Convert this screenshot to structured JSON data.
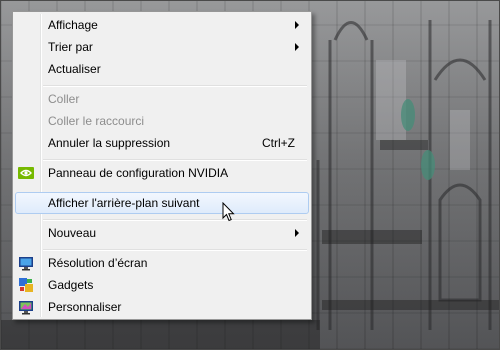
{
  "context_menu": {
    "items": [
      {
        "label": "Affichage"
      },
      {
        "label": "Trier par"
      },
      {
        "label": "Actualiser"
      },
      {
        "label": "Coller"
      },
      {
        "label": "Coller le raccourci"
      },
      {
        "label": "Annuler la suppression",
        "shortcut": "Ctrl+Z"
      },
      {
        "label": "Panneau de configuration NVIDIA"
      },
      {
        "label": "Afficher l'arrière-plan suivant"
      },
      {
        "label": "Nouveau"
      },
      {
        "label": "Résolution d’écran"
      },
      {
        "label": "Gadgets"
      },
      {
        "label": "Personnaliser"
      }
    ],
    "submenu_items": [
      "Affichage",
      "Trier par",
      "Nouveau"
    ],
    "disabled_items": [
      "Coller",
      "Coller le raccourci"
    ],
    "highlighted_item": "Afficher l'arrière-plan suivant",
    "icons": {
      "nvidia": "nvidia-logo-icon",
      "resolution": "monitor-icon",
      "gadgets": "gadgets-icon",
      "personalize": "personalize-monitor-icon"
    }
  },
  "colors": {
    "menu_background": "#f0f0f0",
    "menu_border": "#979797",
    "highlight_border": "#aeccf1",
    "highlight_fill": "#dfebfb",
    "disabled_text": "#8d8d8d",
    "nvidia_green": "#76b900"
  }
}
